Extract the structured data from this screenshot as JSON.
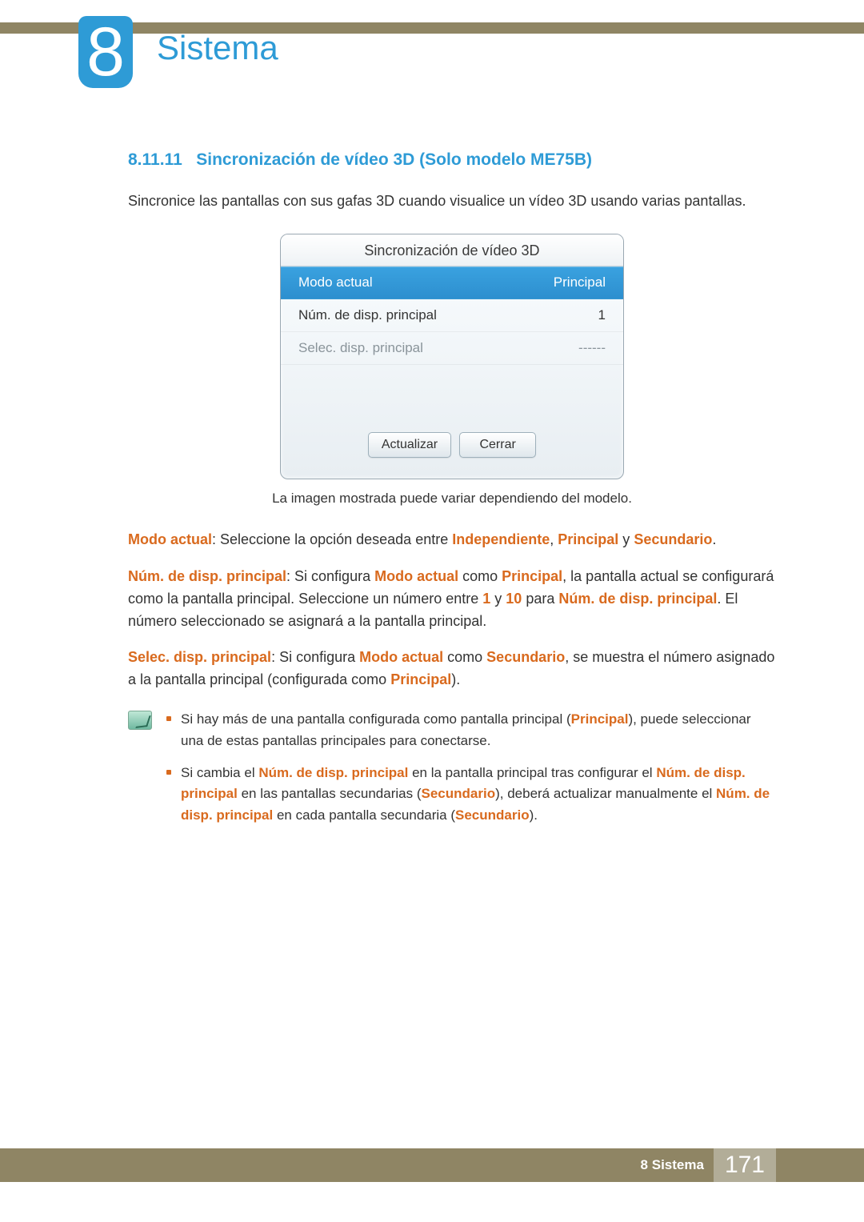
{
  "chapter": {
    "number": "8",
    "title": "Sistema"
  },
  "section": {
    "number": "8.11.11",
    "title": "Sincronización de vídeo 3D (Solo modelo ME75B)"
  },
  "intro": "Sincronice las pantallas con sus gafas 3D cuando visualice un vídeo 3D usando varias pantallas.",
  "dialog": {
    "title": "Sincronización de vídeo 3D",
    "rows": [
      {
        "label": "Modo actual",
        "value": "Principal",
        "selected": true,
        "disabled": false
      },
      {
        "label": "Núm. de disp. principal",
        "value": "1",
        "selected": false,
        "disabled": false
      },
      {
        "label": "Selec. disp. principal",
        "value": "------",
        "selected": false,
        "disabled": true
      }
    ],
    "buttons": {
      "refresh": "Actualizar",
      "close": "Cerrar"
    }
  },
  "caption": "La imagen mostrada puede variar dependiendo del modelo.",
  "paragraphs": {
    "p1": {
      "lead": "Modo actual",
      "t1": ": Seleccione la opción deseada entre ",
      "o1": "Independiente",
      "c1": ", ",
      "o2": "Principal",
      "c2": " y ",
      "o3": "Secundario",
      "end": "."
    },
    "p2": {
      "lead": "Núm. de disp. principal",
      "t1": ": Si configura ",
      "h1": "Modo actual",
      "t2": " como ",
      "h2": "Principal",
      "t3": ", la pantalla actual se configurará como la pantalla principal. Seleccione un número entre ",
      "h3": "1",
      "t4": " y ",
      "h4": "10",
      "t5": " para ",
      "h5": "Núm. de disp. principal",
      "t6": ". El número seleccionado se asignará a la pantalla principal."
    },
    "p3": {
      "lead": "Selec. disp. principal",
      "t1": ": Si configura ",
      "h1": "Modo actual",
      "t2": " como ",
      "h2": "Secundario",
      "t3": ", se muestra el número asignado a la pantalla principal (configurada como ",
      "h3": "Principal",
      "t4": ")."
    }
  },
  "notes": {
    "n1": {
      "t1": "Si hay más de una pantalla configurada como pantalla principal (",
      "h1": "Principal",
      "t2": "), puede seleccionar una de estas pantallas principales para conectarse."
    },
    "n2": {
      "t1": "Si cambia el ",
      "h1": "Núm. de disp. principal",
      "t2": " en la pantalla principal tras configurar el ",
      "h2": "Núm. de disp. principal",
      "t3": " en las pantallas secundarias (",
      "h3": "Secundario",
      "t4": "), deberá actualizar manualmente el ",
      "h4": "Núm. de disp. principal",
      "t5": " en cada pantalla secundaria (",
      "h5": "Secundario",
      "t6": ")."
    }
  },
  "footer": {
    "label": "8 Sistema",
    "page": "171"
  }
}
